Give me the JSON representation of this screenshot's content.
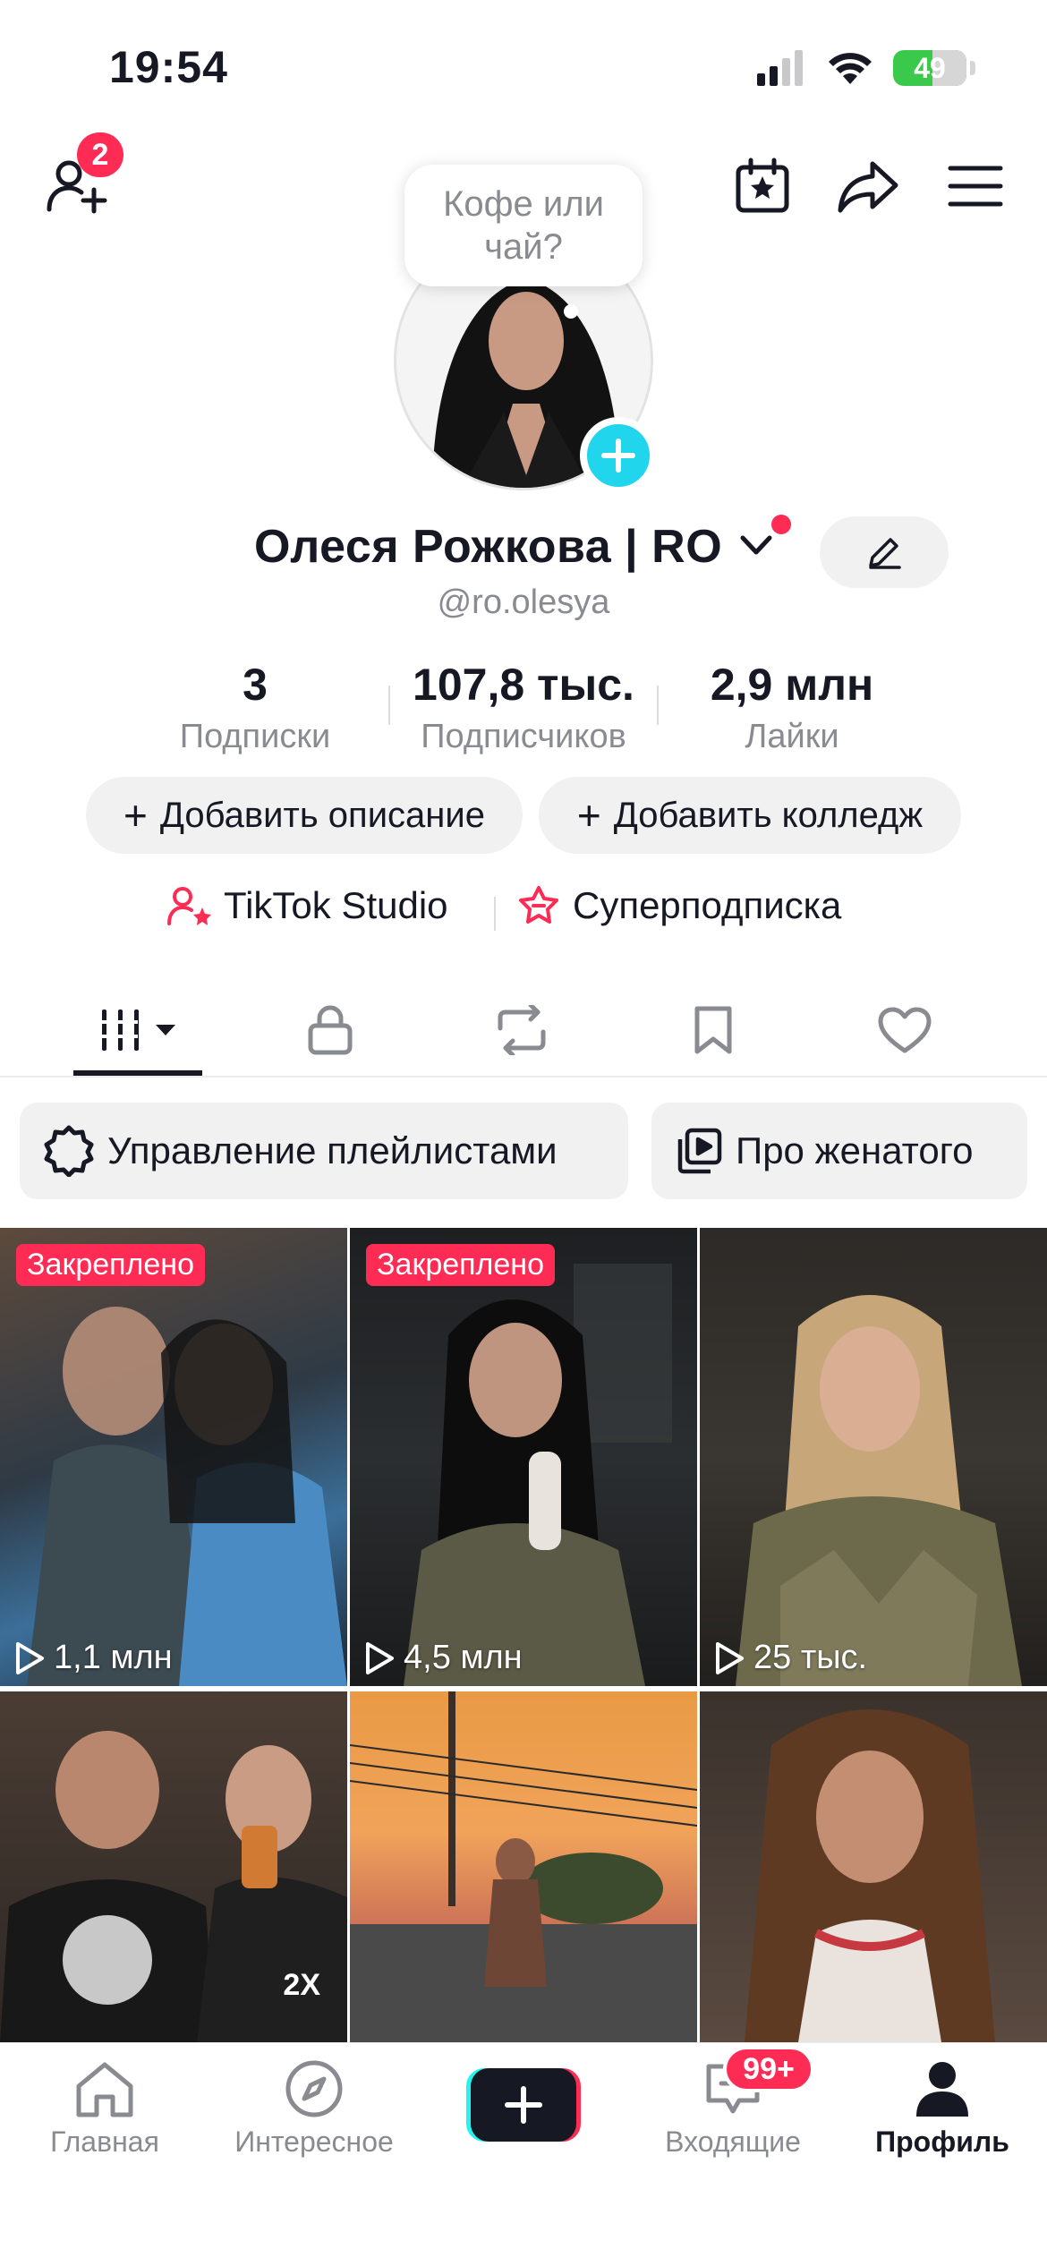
{
  "status_bar": {
    "time": "19:54",
    "battery": "49"
  },
  "header": {
    "add_friends_badge": "2"
  },
  "profile": {
    "note_bubble": "Кофе или чай?",
    "name": "Олеся Рожкова | RO",
    "username": "@ro.olesya"
  },
  "stats": [
    {
      "value": "3",
      "label": "Подписки"
    },
    {
      "value": "107,8 тыс.",
      "label": "Подписчиков"
    },
    {
      "value": "2,9 млн",
      "label": "Лайки"
    }
  ],
  "actions": {
    "add_bio": "Добавить описание",
    "add_college": "Добавить колледж"
  },
  "links": {
    "studio": "TikTok Studio",
    "subscription": "Суперподписка"
  },
  "tabs": [
    "videos",
    "private",
    "reposts",
    "favorites",
    "liked"
  ],
  "playlists": {
    "manage": "Управление плейлистами",
    "playlist_name": "Про женатого"
  },
  "videos": [
    {
      "pinned": "Закреплено",
      "views": "1,1 млн"
    },
    {
      "pinned": "Закреплено",
      "views": "4,5 млн"
    },
    {
      "views": "25 тыс."
    },
    {
      "speed": "2X"
    },
    {},
    {}
  ],
  "bottom_nav": {
    "home": "Главная",
    "discover": "Интересное",
    "inbox": "Входящие",
    "inbox_badge": "99+",
    "profile": "Профиль"
  },
  "colors": {
    "accent_red": "#fe2c55",
    "accent_cyan": "#20d5ec",
    "text_primary": "#161823",
    "text_secondary": "#8a8b91"
  }
}
